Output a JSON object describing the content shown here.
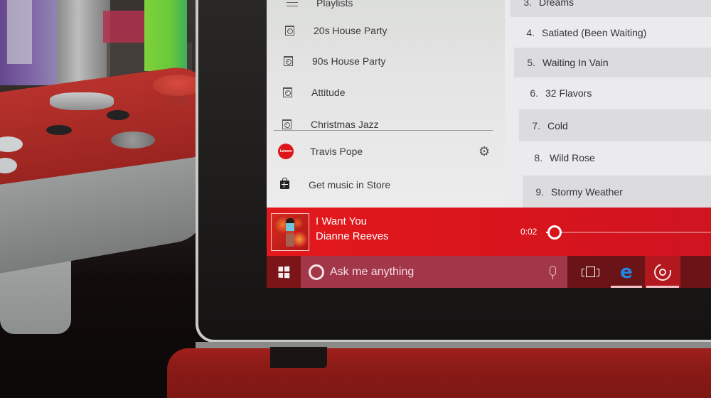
{
  "colors": {
    "accent": "#e3191c",
    "taskbar": "#6a1417",
    "search_box": "#a3374a",
    "edge_blue": "#1e88e5",
    "nav_background": "#e6e6e6"
  },
  "nav": {
    "playlists_header": "Playlists",
    "add_playlist_icon": "plus-icon",
    "playlists": [
      {
        "label": "20s House Party",
        "icon": "playlist-icon"
      },
      {
        "label": "90s House Party",
        "icon": "playlist-icon"
      },
      {
        "label": "Attitude",
        "icon": "playlist-icon"
      },
      {
        "label": "Christmas Jazz",
        "icon": "playlist-icon"
      }
    ],
    "account": {
      "name": "Travis Pope",
      "avatar_text": "Lenovo",
      "settings_icon": "gear-icon"
    },
    "store_link": {
      "label": "Get music in Store",
      "icon": "store-icon"
    }
  },
  "tracks": [
    {
      "number": "3.",
      "title": "Dreams"
    },
    {
      "number": "4.",
      "title": "Satiated (Been Waiting)"
    },
    {
      "number": "5.",
      "title": "Waiting In Vain"
    },
    {
      "number": "6.",
      "title": "32 Flavors"
    },
    {
      "number": "7.",
      "title": "Cold"
    },
    {
      "number": "8.",
      "title": "Wild Rose"
    },
    {
      "number": "9.",
      "title": "Stormy Weather"
    }
  ],
  "now_playing": {
    "title": "I Want You",
    "artist": "Dianne Reeves",
    "elapsed": "0:02",
    "progress_fraction": 0.01
  },
  "taskbar": {
    "search_placeholder": "Ask me anything",
    "start_icon": "windows-logo-icon",
    "mic_icon": "microphone-icon",
    "apps": [
      {
        "name": "Task View",
        "icon": "task-view-icon",
        "running": false
      },
      {
        "name": "Microsoft Edge",
        "icon": "edge-icon",
        "glyph": "e",
        "running": true
      },
      {
        "name": "Groove Music",
        "icon": "groove-music-icon",
        "running": true,
        "active": true
      }
    ]
  }
}
